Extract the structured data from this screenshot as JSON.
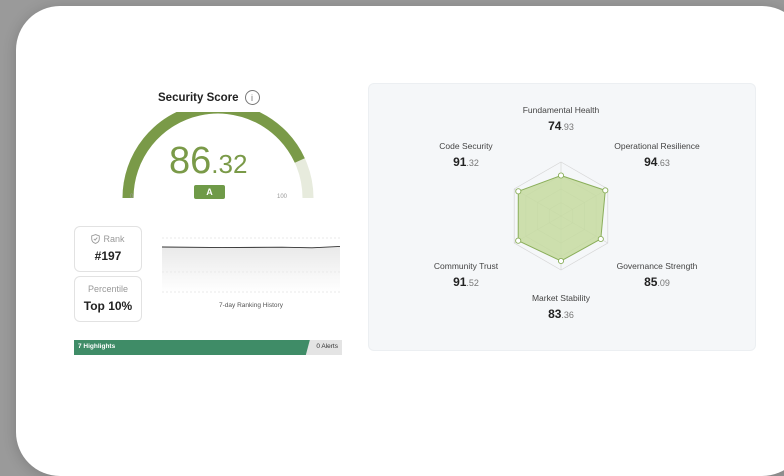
{
  "security": {
    "title": "Security Score",
    "info_icon": "i",
    "score_int": "86",
    "score_dec": ".32",
    "score_value": 86.32,
    "grade": "A",
    "gauge_min": "0",
    "gauge_max": "100"
  },
  "rank": {
    "label": "Rank",
    "value": "#197"
  },
  "percentile": {
    "label": "Percentile",
    "value": "Top 10%"
  },
  "history": {
    "label": "7-day Ranking History"
  },
  "highlights": {
    "label": "7 Highlights",
    "alerts": "0 Alerts",
    "fill_fraction": 0.88
  },
  "dimensions": [
    {
      "name": "Fundamental Health",
      "int": "74",
      "dec": ".93",
      "value": 74.93
    },
    {
      "name": "Operational Resilience",
      "int": "94",
      "dec": ".63",
      "value": 94.63
    },
    {
      "name": "Governance Strength",
      "int": "85",
      "dec": ".09",
      "value": 85.09
    },
    {
      "name": "Market Stability",
      "int": "83",
      "dec": ".36",
      "value": 83.36
    },
    {
      "name": "Community Trust",
      "int": "91",
      "dec": ".52",
      "value": 91.52
    },
    {
      "name": "Code Security",
      "int": "91",
      "dec": ".32",
      "value": 91.32
    }
  ],
  "colors": {
    "accent": "#7a9a48",
    "grade_bg": "#6f9a48",
    "highlight_bar": "#3f8c67",
    "gauge_track": "#e7ebdd",
    "radar_fill": "#c5dba0",
    "radar_stroke": "#8aae5a"
  }
}
